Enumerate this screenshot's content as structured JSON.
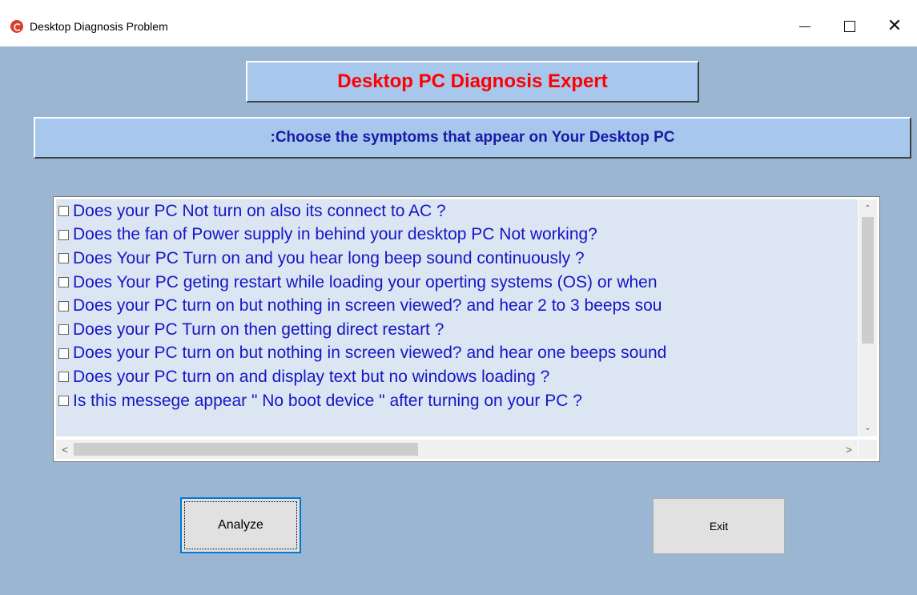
{
  "window": {
    "title": "Desktop Diagnosis Problem",
    "controls": {
      "minimize_icon": "minimize-icon",
      "maximize_icon": "maximize-icon",
      "close_icon": "close-icon",
      "close_glyph": "✕"
    }
  },
  "header": {
    "title": "Desktop PC Diagnosis Expert",
    "subtitle": ":Choose the symptoms that appear on Your Desktop PC"
  },
  "symptoms": [
    {
      "label": "Does your PC Not turn on also its connect to AC ?",
      "checked": false
    },
    {
      "label": "Does the fan of Power supply in behind your desktop PC Not working?",
      "checked": false
    },
    {
      "label": "Does Your PC Turn on and you hear long beep sound continuously ?",
      "checked": false
    },
    {
      "label": "Does Your PC geting restart while loading your operting systems (OS) or when",
      "checked": false
    },
    {
      "label": "Does your PC turn on but nothing in screen viewed? and hear 2 to 3 beeps sou",
      "checked": false
    },
    {
      "label": "Does your PC Turn on then getting direct restart ?",
      "checked": false
    },
    {
      "label": "Does your PC turn on but nothing in screen viewed? and hear one beeps sound",
      "checked": false
    },
    {
      "label": "Does your PC turn on and display text but no windows loading ?",
      "checked": false
    },
    {
      "label": "Is this messege appear \" No boot device \" after turning on your PC ?",
      "checked": false
    }
  ],
  "scroll_arrows": {
    "up": "⌃",
    "down": "⌄",
    "left": "<",
    "right": ">"
  },
  "buttons": {
    "analyze": "Analyze",
    "exit": "Exit"
  },
  "colors": {
    "window_bg": "#9bb6d2",
    "header_bg": "#a7c7ec",
    "title_red": "#ff0000",
    "subtitle_blue": "#1a1aa8",
    "list_text": "#1515c8",
    "list_bg": "#dce6f2"
  }
}
